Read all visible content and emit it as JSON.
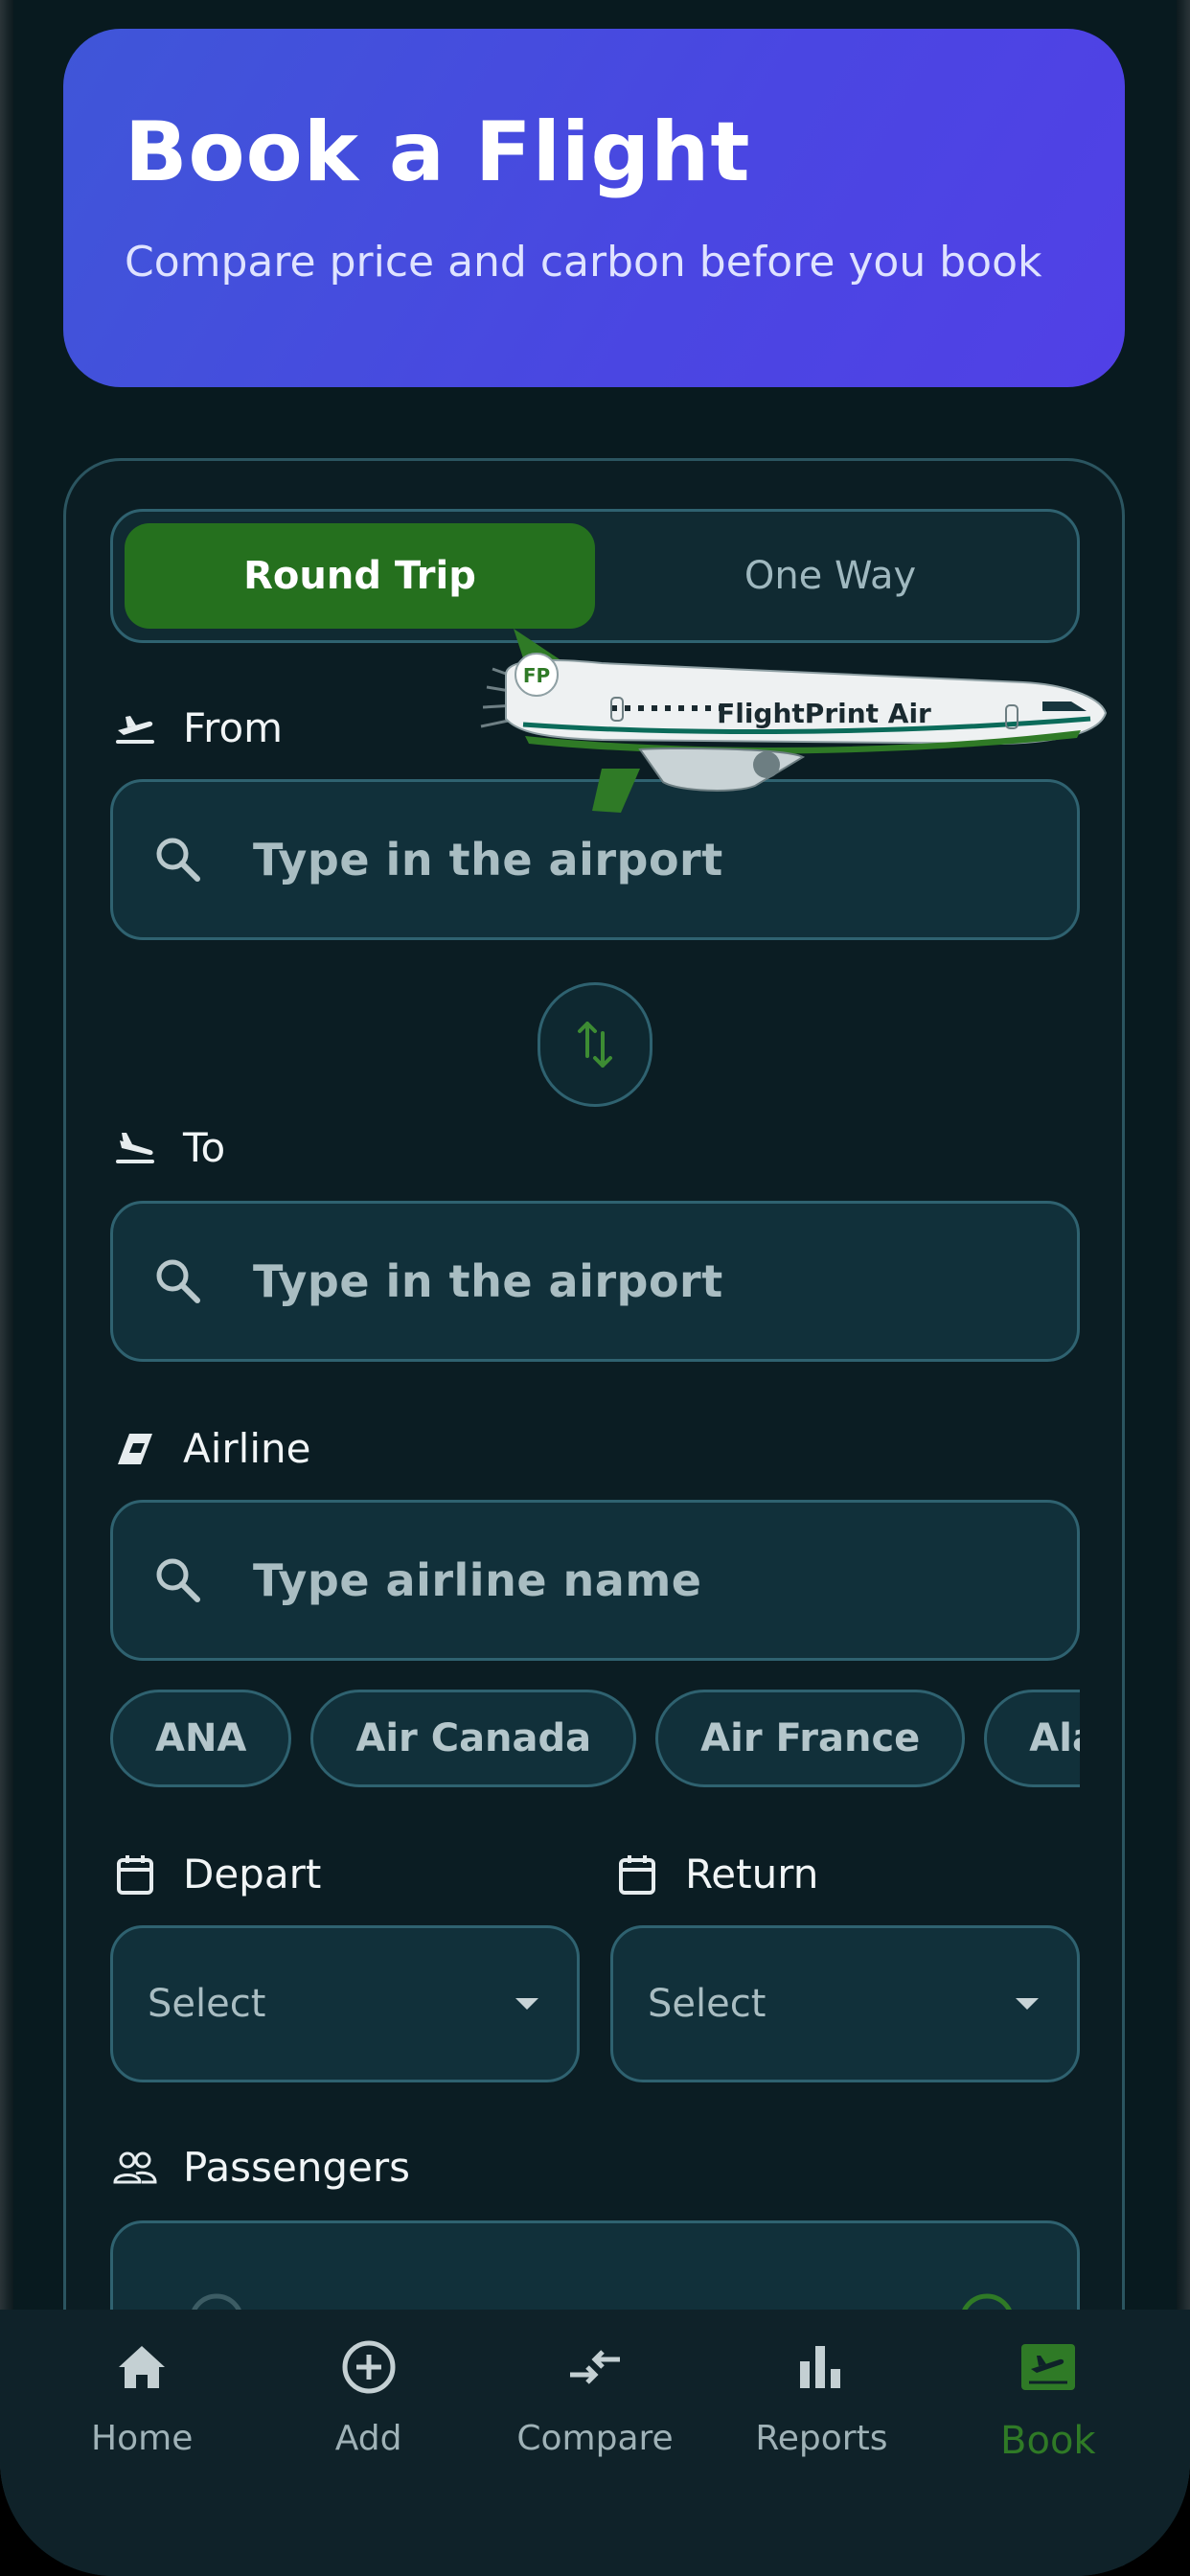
{
  "header": {
    "title": "Book a Flight",
    "subtitle": "Compare price and carbon before you book"
  },
  "trip_type": {
    "options": [
      "Round Trip",
      "One Way"
    ],
    "selected": "Round Trip"
  },
  "from": {
    "label": "From",
    "placeholder": "Type in the airport"
  },
  "to": {
    "label": "To",
    "placeholder": "Type in the airport"
  },
  "airline": {
    "label": "Airline",
    "placeholder": "Type airline name",
    "chips": [
      "ANA",
      "Air Canada",
      "Air France",
      "Alaska"
    ]
  },
  "depart": {
    "label": "Depart",
    "value": "Select"
  },
  "return": {
    "label": "Return",
    "value": "Select"
  },
  "passengers": {
    "label": "Passengers"
  },
  "illustration": {
    "tail_badge": "FP",
    "livery_text": "FlightPrint Air"
  },
  "tabbar": {
    "items": [
      {
        "label": "Home",
        "icon": "home-icon"
      },
      {
        "label": "Add",
        "icon": "add-circle-icon"
      },
      {
        "label": "Compare",
        "icon": "compare-arrows-icon"
      },
      {
        "label": "Reports",
        "icon": "bar-chart-icon"
      },
      {
        "label": "Book",
        "icon": "flight-ticket-icon"
      }
    ],
    "active": "Book"
  },
  "colors": {
    "accent_green": "#25701e",
    "hero_gradient_start": "#3f56d8",
    "hero_gradient_end": "#5140e6",
    "background": "#081a1f"
  }
}
